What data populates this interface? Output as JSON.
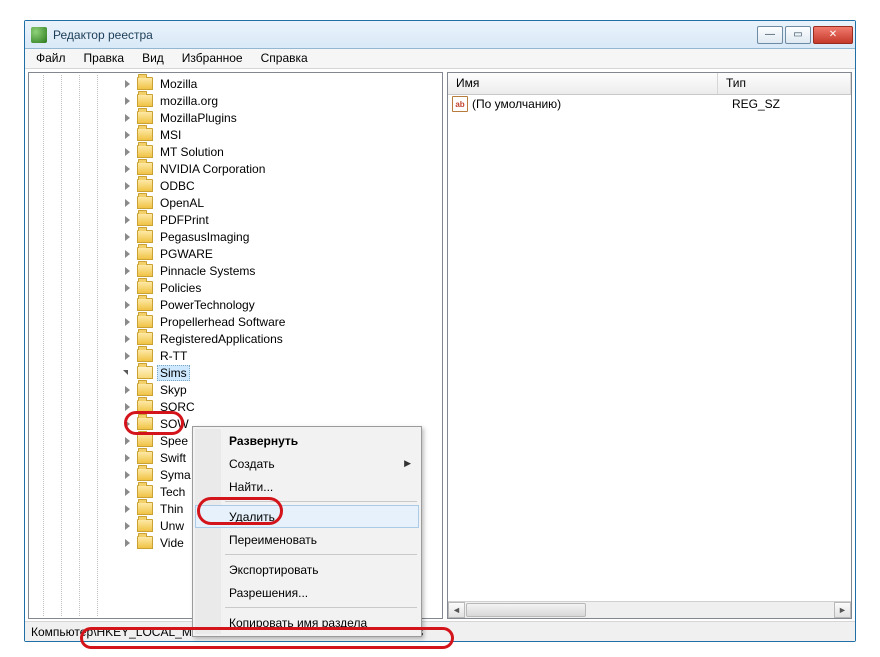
{
  "window": {
    "title": "Редактор реестра"
  },
  "menubar": [
    "Файл",
    "Правка",
    "Вид",
    "Избранное",
    "Справка"
  ],
  "tree": {
    "items": [
      "Mozilla",
      "mozilla.org",
      "MozillaPlugins",
      "MSI",
      "MT Solution",
      "NVIDIA Corporation",
      "ODBC",
      "OpenAL",
      "PDFPrint",
      "PegasusImaging",
      "PGWARE",
      "Pinnacle Systems",
      "Policies",
      "PowerTechnology",
      "Propellerhead Software",
      "RegisteredApplications",
      "R-TT",
      "Sims",
      "Skyp",
      "SORC",
      "SOW",
      "Spee",
      "Swift",
      "Syma",
      "Tech",
      "Thin",
      "Unw",
      "Vide"
    ],
    "selected_index": 17,
    "open_index": 17
  },
  "listview": {
    "columns": {
      "name": "Имя",
      "type": "Тип"
    },
    "rows": [
      {
        "icon": "ab",
        "name": "(По умолчанию)",
        "type": "REG_SZ"
      }
    ]
  },
  "context_menu": {
    "items": [
      {
        "label": "Развернуть",
        "bold": true
      },
      {
        "label": "Создать",
        "submenu": true
      },
      {
        "label": "Найти..."
      },
      {
        "sep": true
      },
      {
        "label": "Удалить",
        "hover": true
      },
      {
        "label": "Переименовать"
      },
      {
        "sep": true
      },
      {
        "label": "Экспортировать"
      },
      {
        "label": "Разрешения..."
      },
      {
        "sep": true
      },
      {
        "label": "Копировать имя раздела"
      }
    ]
  },
  "status": {
    "prefix": "Компьюте",
    "path": "р\\HKEY_LOCAL_MACHINE\\SOFTWARE\\Wow6432Node\\Sims"
  }
}
